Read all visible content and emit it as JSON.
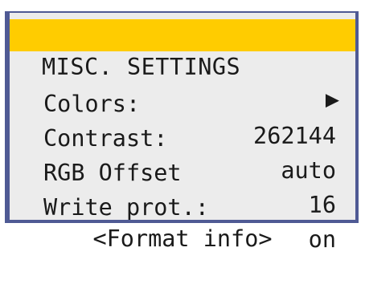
{
  "menu": {
    "title": "MISC. SETTINGS",
    "title_arrow": "▶",
    "highlight_color": "#ffcc00",
    "frame_color": "#4f5a94",
    "items": [
      {
        "label": "Colors:",
        "value": "262144"
      },
      {
        "label": "Contrast:",
        "value": "auto"
      },
      {
        "label": "RGB Offset",
        "value": "16"
      },
      {
        "label": "Write prot.:",
        "value": "on"
      }
    ],
    "action": "<Format info>"
  }
}
